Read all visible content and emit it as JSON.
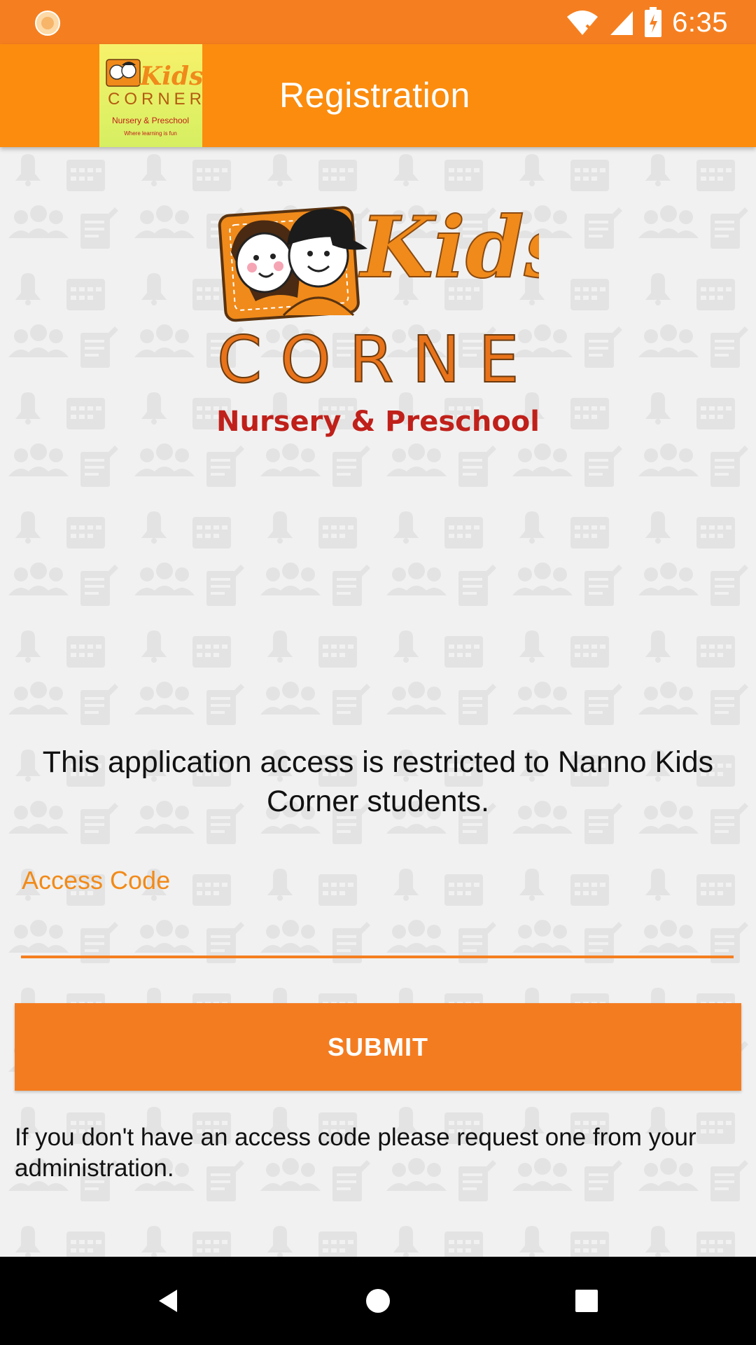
{
  "status_bar": {
    "time": "6:35",
    "left_icon": "notification-circle-icon",
    "icons": [
      "wifi-off-icon",
      "signal-icon",
      "battery-charging-icon"
    ]
  },
  "app_bar": {
    "title": "Registration",
    "logo": {
      "line1": "Kids",
      "line2": "CORNER",
      "line3": "Nursery & Preschool",
      "line4": "Where learning is fun"
    }
  },
  "main_logo": {
    "line1": "Kids",
    "line2": "CORNER",
    "line3": "Nursery & Preschool"
  },
  "notice": "This application access is restricted to Nanno Kids Corner students.",
  "form": {
    "access_code_label": "Access Code",
    "access_code_value": "",
    "submit_label": "SUBMIT"
  },
  "help": "If you don't have an access code please request one from your administration.",
  "colors": {
    "status_bar": "#f57f20",
    "app_bar": "#fb8c0e",
    "accent": "#f47c20",
    "label": "#f28a18"
  },
  "nav_bar": {
    "icons": [
      "back-icon",
      "home-icon",
      "recents-icon"
    ]
  }
}
